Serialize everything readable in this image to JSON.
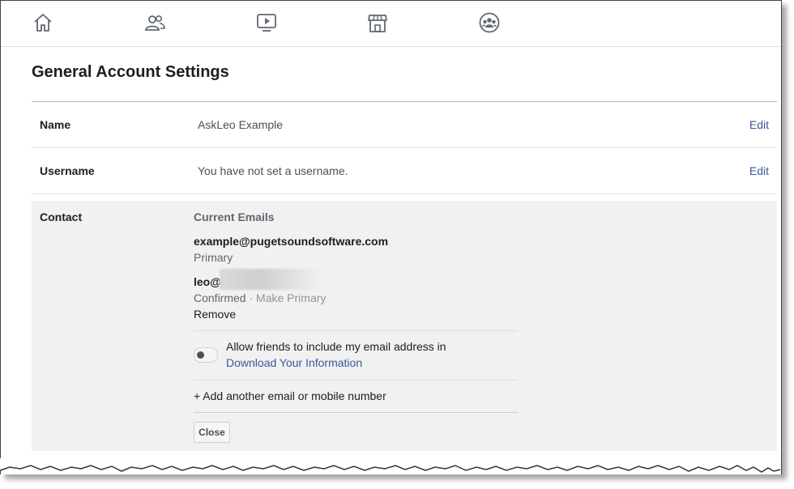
{
  "nav": {
    "icons": [
      "home-icon",
      "friends-icon",
      "watch-icon",
      "marketplace-icon",
      "groups-icon"
    ]
  },
  "page": {
    "title": "General Account Settings"
  },
  "rows": {
    "name": {
      "label": "Name",
      "value": "AskLeo Example",
      "edit": "Edit"
    },
    "username": {
      "label": "Username",
      "value": "You have not set a username.",
      "edit": "Edit"
    }
  },
  "contact": {
    "label": "Contact",
    "current_emails": "Current Emails",
    "email1": "example@pugetsoundsoftware.com",
    "email1_status": "Primary",
    "email2": "leo@",
    "email2_status": "Confirmed",
    "separator": "·",
    "make_primary": "Make Primary",
    "remove": "Remove",
    "allow_text": "Allow friends to include my email address in",
    "download_link": "Download Your Information",
    "add_more": "+ Add another email or mobile number",
    "close": "Close"
  },
  "colors": {
    "link": "#385898",
    "panel_bg": "#f1f1f1"
  }
}
